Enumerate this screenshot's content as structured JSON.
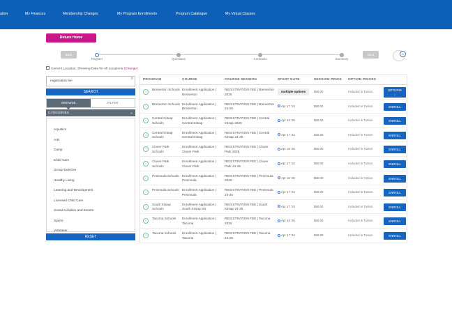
{
  "nav": {
    "items": [
      "ation",
      "My Finances",
      "Membership Changes",
      "My Program Enrollments",
      "Program Catalogue",
      "My Virtual Classes"
    ]
  },
  "return_home": "Return Home",
  "wizard": {
    "back": "Back",
    "next": "Next",
    "steps": [
      "Register",
      "Questions",
      "Contracts",
      "Summary"
    ],
    "cart_count": "0"
  },
  "location": {
    "text": "Current Location: Showing Data for All Locations",
    "change": "(Change)"
  },
  "sidebar": {
    "search_value": "registration fee",
    "search_button": "SEARCH",
    "tab_browse": "BROWSE",
    "tab_filter": "FILTER",
    "categories_label": "CATEGORIES",
    "categories": [
      "Aquatics",
      "Arts",
      "Camp",
      "Child Care",
      "Group Exercise",
      "Healthy Living",
      "Learning and Development",
      "Licensed Child Care",
      "Social Activities and Events",
      "Sports",
      "Volunteer"
    ],
    "reset": "RESET"
  },
  "table": {
    "headers": [
      "PROGRAM",
      "COURSE",
      "COURSE SESSION",
      "START DATE",
      "SESSION PRICE",
      "OPTION PRICES"
    ],
    "rows": [
      {
        "program": "Bremerton Schools",
        "course": "Enrollment Application | Bremerton",
        "session": "REGISTRATION FEE | Bremerton 2025",
        "date": "multiple options",
        "price": "$50.00",
        "option": "Included in Tuition",
        "action": "OPTIONS"
      },
      {
        "program": "Bremerton Schools",
        "course": "Enrollment Application | Bremerton",
        "session": "REGISTRATION FEE | Bremerton 24-25",
        "date": "Apr 17 '24",
        "price": "$50.00",
        "option": "Included in Tuition",
        "action": "ENROLL"
      },
      {
        "program": "Central Kitsap Schools",
        "course": "Enrollment Application | Central Kitsap",
        "session": "REGISTRATION FEE | Central Kitsap 2025",
        "date": "Apr 16 '25",
        "price": "$50.00",
        "option": "Included in Tuition",
        "action": "ENROLL"
      },
      {
        "program": "Central Kitsap Schools",
        "course": "Enrollment Application | Central Kitsap",
        "session": "REGISTRATION FEE | Central Kitsap 24-25",
        "date": "Apr 17 '24",
        "price": "$50.00",
        "option": "Included in Tuition",
        "action": "ENROLL"
      },
      {
        "program": "Clover Park Schools",
        "course": "Enrollment Application | Clover Park",
        "session": "REGISTRATION FEE | Clover Park 2025",
        "date": "Apr 16 '25",
        "price": "$50.00",
        "option": "Included in Tuition",
        "action": "ENROLL"
      },
      {
        "program": "Clover Park Schools",
        "course": "Enrollment Application | Clover Park",
        "session": "REGISTRATION FEE | Clover Park 24-25",
        "date": "Apr 17 '24",
        "price": "$50.00",
        "option": "Included in Tuition",
        "action": "ENROLL"
      },
      {
        "program": "Peninsula Schools",
        "course": "Enrollment Application | Peninsula",
        "session": "REGISTRATION FEE | Peninsula 2025",
        "date": "Apr 16 '25",
        "price": "$50.00",
        "option": "Included in Tuition",
        "action": "ENROLL"
      },
      {
        "program": "Peninsula Schools",
        "course": "Enrollment Application | Peninsula",
        "session": "REGISTRATION FEE | Peninsula 24-25",
        "date": "Apr 17 '24",
        "price": "$50.00",
        "option": "Included in Tuition",
        "action": "ENROLL"
      },
      {
        "program": "South Kitsap Schools",
        "course": "Enrollment Application | South Kitsap SD",
        "session": "REGISTRATION FEE | South Kitsap 24-25",
        "date": "Apr 17 '24",
        "price": "$50.00",
        "option": "Included in Tuition",
        "action": "ENROLL"
      },
      {
        "program": "Tacoma Schools",
        "course": "Enrollment Application | Tacoma",
        "session": "REGISTRATION FEE | Tacoma 2025",
        "date": "Apr 16 '25",
        "price": "$50.00",
        "option": "Included in Tuition",
        "action": "ENROLL"
      },
      {
        "program": "Tacoma Schools",
        "course": "Enrollment Application | Tacoma",
        "session": "REGISTRATION FEE | Tacoma 24-25",
        "date": "Apr 17 '24",
        "price": "$50.00",
        "option": "Included in Tuition",
        "action": "ENROLL"
      }
    ]
  },
  "colors": {
    "nav_bg": "#0d5fb8",
    "accent_magenta": "#c8178a",
    "primary_blue": "#1565c0",
    "sidebar_gray": "#5d6b78"
  }
}
